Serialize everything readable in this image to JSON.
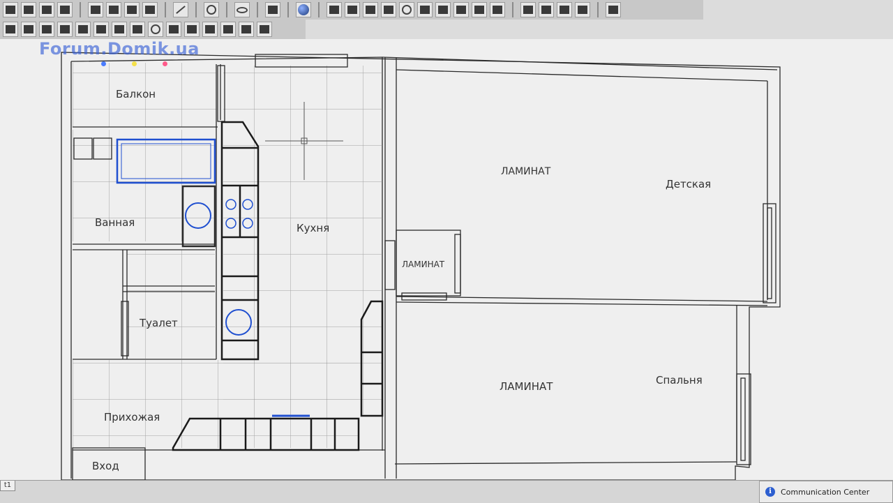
{
  "watermark": "Forum.Domik.ua",
  "watermark_dot_colors": [
    "#4a7cff",
    "#f4e04a",
    "#ff5a8a"
  ],
  "rooms": {
    "balkon": "Балкон",
    "vannaya": "Ванная",
    "kuhnya": "Кухня",
    "tualet": "Туалет",
    "prihozhaya": "Прихожая",
    "vhod": "Вход",
    "detskaya": "Детская",
    "spalnya": "Спальня"
  },
  "floor_labels": {
    "hall": "ЛАМИНАТ",
    "detskaya": "ЛАМИНАТ",
    "spalnya": "ЛАМИНАТ"
  },
  "status": {
    "tab_label": "t1",
    "communication_center": "Communication Center"
  },
  "colors": {
    "wall": "#2a2a2a",
    "fixture_blue": "#1f4fd0",
    "grid": "#8f8f8f"
  }
}
